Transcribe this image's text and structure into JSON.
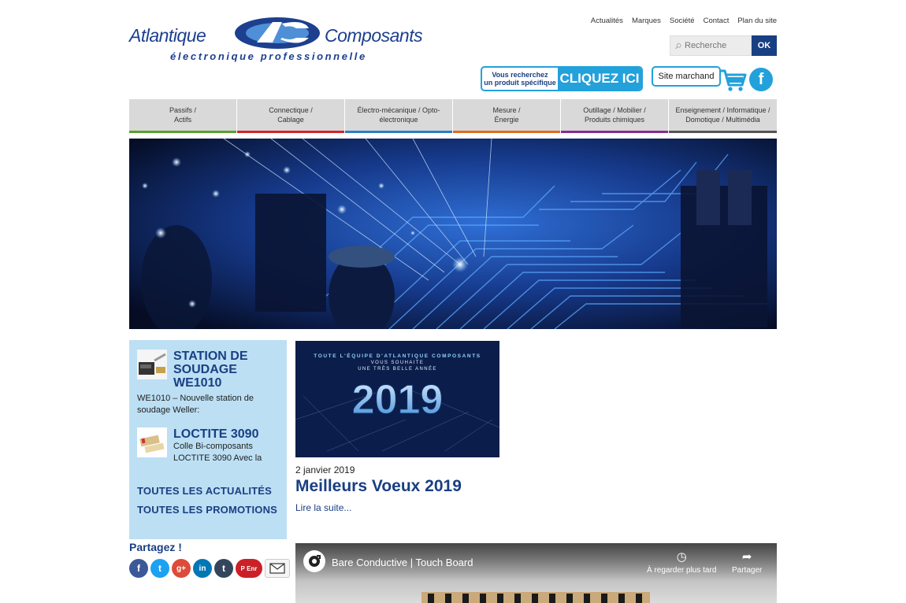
{
  "logo": {
    "left_word": "Atlantique",
    "right_word": "Composants",
    "tagline": "électronique professionnelle"
  },
  "topnav": [
    "Actualités",
    "Marques",
    "Société",
    "Contact",
    "Plan du site"
  ],
  "search": {
    "placeholder": "Recherche",
    "button": "OK"
  },
  "cta": {
    "small_line1": "Vous recherchez",
    "small_line2": "un produit spécifique",
    "big": "CLIQUEZ ICI"
  },
  "shop": {
    "label": "Site marchand"
  },
  "categories": [
    {
      "line1": "Passifs /",
      "line2": "Actifs",
      "color": "#5aa02c"
    },
    {
      "line1": "Connectique /",
      "line2": "Cablage",
      "color": "#d6232a"
    },
    {
      "line1": "Électro-mécanique / Opto-",
      "line2": "électronique",
      "color": "#2b7fc4"
    },
    {
      "line1": "Mesure /",
      "line2": "Énergie",
      "color": "#e36b1e"
    },
    {
      "line1": "Outillage / Mobilier /",
      "line2": "Produits chimiques",
      "color": "#8a2b8f"
    },
    {
      "line1": "Enseignement / Informatique /",
      "line2": "Domotique / Multimédia",
      "color": "#555555"
    }
  ],
  "sidebar": {
    "news": [
      {
        "title": "STATION DE SOUDAGE WE1010",
        "text": "WE1010 – Nouvelle station de soudage Weller:"
      },
      {
        "title": "LOCTITE 3090",
        "text": "Colle Bi-composants LOCTITE 3090     Avec la"
      }
    ],
    "link_news": "TOUTES LES ACTUALITÉS",
    "link_promos": "TOUTES LES PROMOTIONS"
  },
  "share": {
    "label": "Partagez !",
    "networks": [
      {
        "name": "facebook",
        "glyph": "f",
        "color": "#3b5998"
      },
      {
        "name": "twitter",
        "glyph": "t",
        "color": "#1da1f2"
      },
      {
        "name": "google-plus",
        "glyph": "g+",
        "color": "#dd4b39"
      },
      {
        "name": "linkedin",
        "glyph": "in",
        "color": "#0077b5"
      },
      {
        "name": "tumblr",
        "glyph": "t",
        "color": "#35465c"
      },
      {
        "name": "pinterest",
        "glyph": "P",
        "color": "#cb2027"
      }
    ],
    "pinterest_label": "Enr"
  },
  "article": {
    "image_header": "TOUTE L'ÉQUIPE D'ATLANTIQUE COMPOSANTS",
    "image_sub1": "VOUS SOUHAITE",
    "image_sub2": "UNE TRÈS BELLE ANNÉE",
    "image_year": "2019",
    "date": "2 janvier 2019",
    "title": "Meilleurs Voeux 2019",
    "more": "Lire la suite..."
  },
  "video": {
    "title": "Bare Conductive | Touch Board",
    "watch_later": "À regarder plus tard",
    "share": "Partager"
  }
}
